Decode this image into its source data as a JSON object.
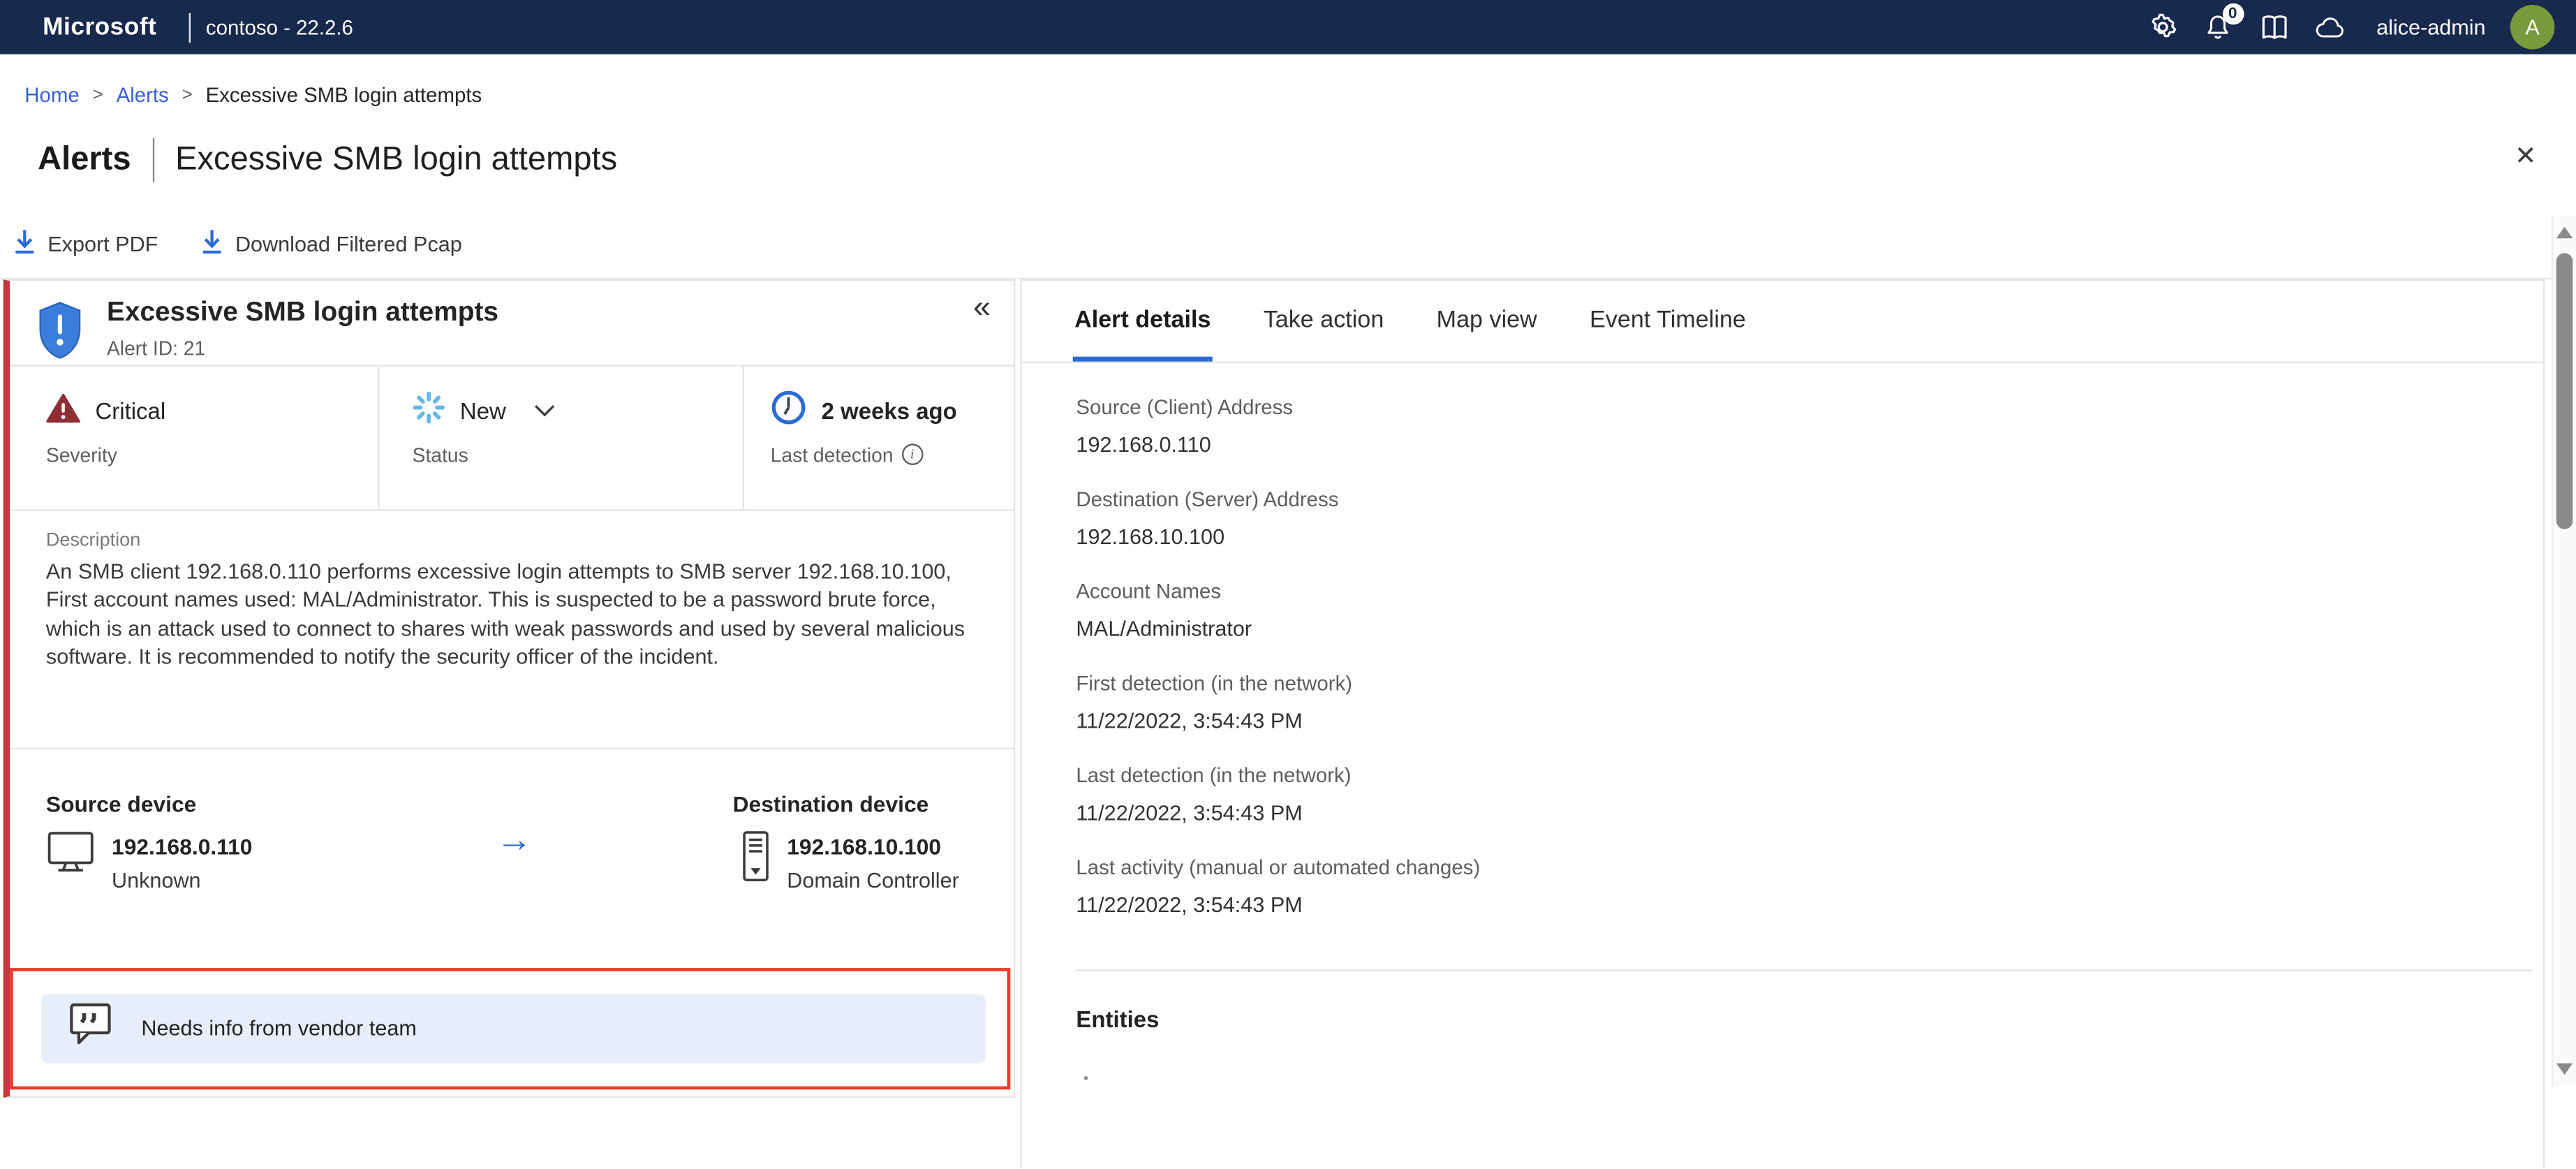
{
  "topbar": {
    "brand": "Microsoft",
    "environment": "contoso - 22.2.6",
    "notification_count": "0",
    "username": "alice-admin",
    "avatar_initial": "A"
  },
  "breadcrumb": {
    "items": [
      "Home",
      "Alerts",
      "Excessive SMB login attempts"
    ],
    "separator": ">"
  },
  "page": {
    "section_title": "Alerts",
    "page_title": "Excessive SMB login attempts",
    "close_glyph": "✕"
  },
  "toolbar": {
    "export_pdf_label": "Export PDF",
    "download_pcap_label": "Download Filtered Pcap"
  },
  "alert_panel": {
    "collapse_glyph": "«",
    "title": "Excessive SMB login attempts",
    "alert_id": "Alert ID: 21",
    "severity": {
      "value": "Critical",
      "label": "Severity"
    },
    "status": {
      "value": "New",
      "label": "Status"
    },
    "detection": {
      "value": "2 weeks ago",
      "label": "Last detection"
    },
    "description_label": "Description",
    "description": "An SMB client 192.168.0.110 performs excessive login attempts to SMB server 192.168.10.100, First account names used: MAL/Administrator. This is suspected to be a password brute force, which is an attack used to connect to shares with weak passwords and used by several malicious software. It is recommended to notify the security officer of the incident.",
    "source_device": {
      "label": "Source device",
      "ip": "192.168.0.110",
      "type": "Unknown"
    },
    "destination_device": {
      "label": "Destination device",
      "ip": "192.168.10.100",
      "type": "Domain Controller"
    },
    "annotation_text": "Needs info from vendor team"
  },
  "details_panel": {
    "tabs": [
      {
        "label": "Alert details"
      },
      {
        "label": "Take action"
      },
      {
        "label": "Map view"
      },
      {
        "label": "Event Timeline"
      }
    ],
    "fields": [
      {
        "label": "Source (Client) Address",
        "value": "192.168.0.110"
      },
      {
        "label": "Destination (Server) Address",
        "value": "192.168.10.100"
      },
      {
        "label": "Account Names",
        "value": "MAL/Administrator"
      },
      {
        "label": "First detection (in the network)",
        "value": "11/22/2022, 3:54:43 PM"
      },
      {
        "label": "Last detection (in the network)",
        "value": "11/22/2022, 3:54:43 PM"
      },
      {
        "label": "Last activity (manual or automated changes)",
        "value": "11/22/2022, 3:54:43 PM"
      }
    ],
    "entities_title": "Entities"
  },
  "colors": {
    "topbar_bg": "#17294d",
    "accent_blue": "#2b6bd4",
    "link_blue": "#3c5fd1",
    "stripe_red": "#c4373e",
    "severity_red": "#8f2e35",
    "annotation_red": "#ee3b2e",
    "annotation_bg": "#e7eefa",
    "status_blue": "#65b7e6",
    "avatar_green": "#78993c",
    "text_primary": "#252423",
    "text_secondary": "#605e5c",
    "border": "#e5e5e5"
  }
}
